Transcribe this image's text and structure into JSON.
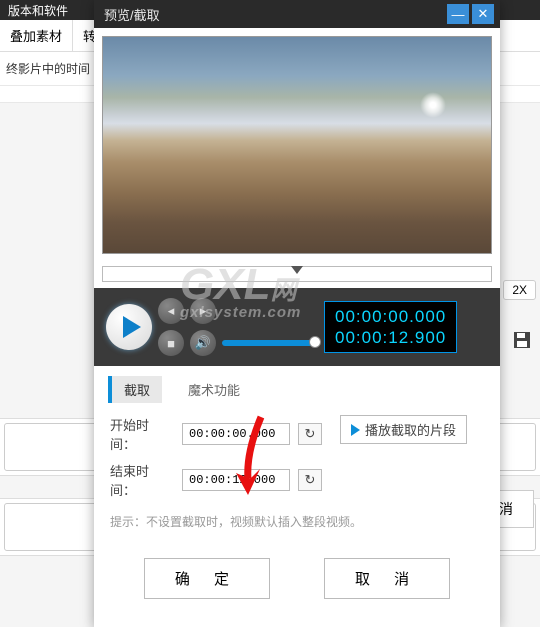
{
  "background": {
    "header_fragment": "版本和软件",
    "tab_overlay": "叠加素材",
    "tab_transform": "转",
    "row1": "终影片中的时间",
    "badge_2x": "2X",
    "cancel_outer": "取 消"
  },
  "dialog": {
    "title": "预览/截取",
    "controls": {
      "time_current": "00:00:00.000",
      "time_total": "00:00:12.900"
    },
    "tabs": {
      "clip": "截取",
      "magic": "魔术功能"
    },
    "form": {
      "start_label": "开始时间：",
      "start_value": "00:00:00.000",
      "end_label": "结束时间：",
      "end_value": "00:00:12.000",
      "play_clip": "播放截取的片段",
      "hint": "提示：不设置截取时，视频默认插入整段视频。"
    },
    "buttons": {
      "ok": "确 定",
      "cancel": "取 消"
    }
  },
  "watermark": {
    "big": "GXL",
    "small": "gxlsystem.com",
    "suffix": "网"
  }
}
